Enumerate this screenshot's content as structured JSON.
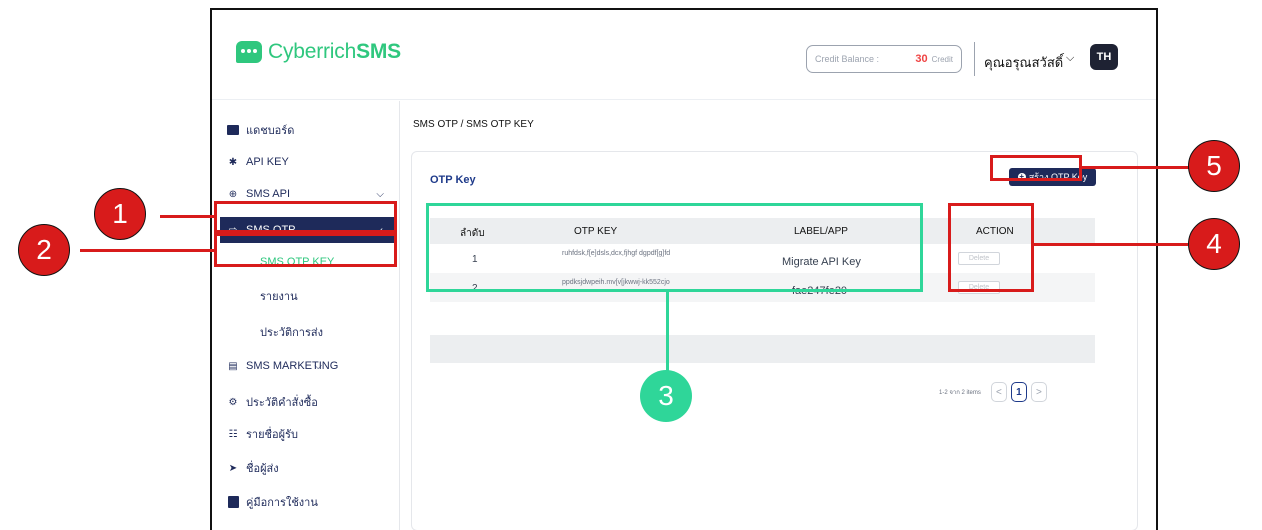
{
  "header": {
    "logo_text_a": "Cyberrich",
    "logo_text_b": "SMS",
    "credit_label": "Credit Balance :",
    "credit_value": "30",
    "credit_unit": "Credit",
    "user_name": "คุณอรุณสวัสดิ์",
    "avatar": "TH"
  },
  "sidebar": {
    "items": [
      {
        "label": "แดชบอร์ด",
        "icon": "dashboard-icon"
      },
      {
        "label": "API KEY",
        "icon": "api-key-icon"
      },
      {
        "label": "SMS API",
        "icon": "sms-api-icon"
      },
      {
        "label": "SMS OTP",
        "icon": "sms-otp-icon"
      },
      {
        "label": "SMS OTP KEY"
      },
      {
        "label": "รายงาน"
      },
      {
        "label": "ประวัติการส่ง"
      },
      {
        "label": "SMS MARKETING",
        "icon": "sms-marketing-icon"
      },
      {
        "label": "ประวัติคำสั่งซื้อ",
        "icon": "order-history-icon"
      },
      {
        "label": "รายชื่อผู้รับ",
        "icon": "recipients-icon"
      },
      {
        "label": "ชื่อผู้ส่ง",
        "icon": "sender-icon"
      },
      {
        "label": "คู่มือการใช้งาน",
        "icon": "manual-icon"
      }
    ]
  },
  "main": {
    "breadcrumb": "SMS OTP / SMS OTP KEY",
    "card_title": "OTP Key",
    "create_button": "สร้าง OTP Key",
    "table": {
      "columns": [
        "ลำดับ",
        "OTP KEY",
        "LABEL/APP",
        "ACTION"
      ],
      "rows": [
        {
          "index": "1",
          "key": "ruhfdsk,f[e]dsls,dcx,fjhgf dgpdf[g]fd",
          "label": "Migrate API Key",
          "action": "Delete"
        },
        {
          "index": "2",
          "key": "ppdksjdwpeih.mv[v[jkwwj-kk552cjo",
          "label": "fae247fe20",
          "action": "Delete"
        }
      ]
    },
    "pagination": {
      "summary": "1-2 จาก 2 items",
      "current": "1",
      "prev": "<",
      "next": ">"
    }
  },
  "callouts": [
    "1",
    "2",
    "3",
    "4",
    "5"
  ],
  "colors": {
    "brand_green": "#2fc77e",
    "navy": "#1e2a5a",
    "callout_red": "#d81b1b",
    "callout_green": "#2fd699",
    "credit_red": "#ef4444"
  }
}
